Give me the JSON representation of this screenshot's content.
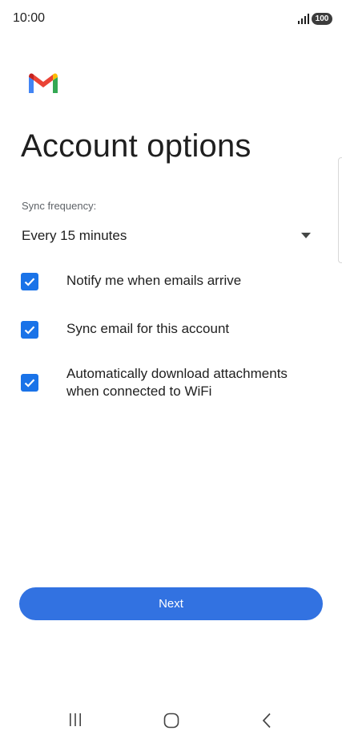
{
  "status_bar": {
    "time": "10:00",
    "battery": "100",
    "icons": [
      "signal-icon",
      "battery-icon"
    ]
  },
  "app": {
    "logo_icon": "gmail-logo",
    "colors": {
      "red": "#ea4335",
      "blue": "#4285f4",
      "green": "#34a853",
      "yellow": "#fbbc04",
      "dark_red": "#c5221f"
    }
  },
  "title": "Account options",
  "sync": {
    "label": "Sync frequency:",
    "value": "Every 15 minutes",
    "icon": "dropdown-arrow-icon"
  },
  "options": [
    {
      "label": "Notify me when emails arrive",
      "checked": true
    },
    {
      "label": "Sync email for this account",
      "checked": true
    },
    {
      "label": "Automatically download attachments when connected to WiFi",
      "checked": true
    }
  ],
  "next_button": {
    "label": "Next",
    "color": "#3272e1"
  },
  "nav_bar": {
    "icons": [
      "recent-apps-icon",
      "home-icon",
      "back-icon"
    ]
  }
}
